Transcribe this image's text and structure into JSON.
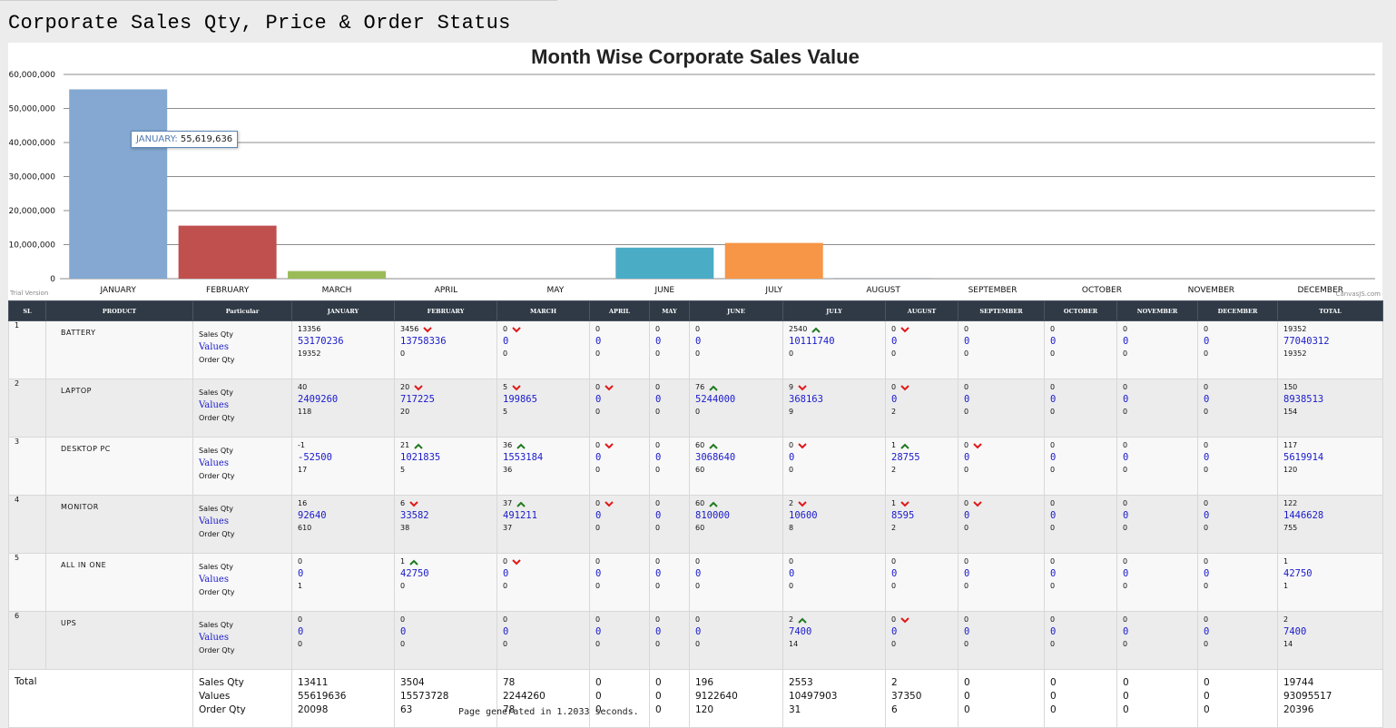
{
  "page": {
    "title": "Corporate Sales Qty, Price & Order Status",
    "footer": "Page generated in 1.2033 seconds."
  },
  "chart_data": {
    "type": "bar",
    "title": "Month Wise Corporate Sales Value",
    "categories": [
      "JANUARY",
      "FEBRUARY",
      "MARCH",
      "APRIL",
      "MAY",
      "JUNE",
      "JULY",
      "AUGUST",
      "SEPTEMBER",
      "OCTOBER",
      "NOVEMBER",
      "DECEMBER"
    ],
    "values": [
      55619636,
      15573728,
      2244260,
      0,
      0,
      9122640,
      10497903,
      37350,
      0,
      0,
      0,
      0
    ],
    "colors": [
      "#84a8d1",
      "#c0504e",
      "#9bbb59",
      "#8064a2",
      "#4bacc6",
      "#4bacc6",
      "#f79646",
      "#2c4d75",
      "#772c2a",
      "#5f7530",
      "#4d3b62",
      "#276a7c"
    ],
    "ylim": [
      0,
      60000000
    ],
    "yticks": [
      "0",
      "10,000,000",
      "20,000,000",
      "30,000,000",
      "40,000,000",
      "50,000,000",
      "60,000,000"
    ],
    "grid": true,
    "tooltip": {
      "label": "JANUARY:",
      "value": "55,619,636"
    },
    "watermark_left": "Trial Version",
    "watermark_right": "CanvasJS.com"
  },
  "table": {
    "headers": [
      "SL",
      "PRODUCT",
      "Particular",
      "JANUARY",
      "FEBRUARY",
      "MARCH",
      "APRIL",
      "MAY",
      "JUNE",
      "JULY",
      "AUGUST",
      "SEPTEMBER",
      "OCTOBER",
      "NOVEMBER",
      "DECEMBER",
      "TOTAL"
    ],
    "particulars": {
      "qty": "Sales Qty",
      "val": "Values",
      "ord": "Order Qty"
    },
    "rows": [
      {
        "sl": "1",
        "product": "BATTERY",
        "cells": [
          {
            "q": "13356",
            "v": "53170236",
            "o": "19352",
            "a": ""
          },
          {
            "q": "3456",
            "v": "13758336",
            "o": "0",
            "a": "down"
          },
          {
            "q": "0",
            "v": "0",
            "o": "0",
            "a": "down"
          },
          {
            "q": "0",
            "v": "0",
            "o": "0",
            "a": ""
          },
          {
            "q": "0",
            "v": "0",
            "o": "0",
            "a": ""
          },
          {
            "q": "0",
            "v": "0",
            "o": "0",
            "a": ""
          },
          {
            "q": "2540",
            "v": "10111740",
            "o": "0",
            "a": "up"
          },
          {
            "q": "0",
            "v": "0",
            "o": "0",
            "a": "down"
          },
          {
            "q": "0",
            "v": "0",
            "o": "0",
            "a": ""
          },
          {
            "q": "0",
            "v": "0",
            "o": "0",
            "a": ""
          },
          {
            "q": "0",
            "v": "0",
            "o": "0",
            "a": ""
          },
          {
            "q": "0",
            "v": "0",
            "o": "0",
            "a": ""
          },
          {
            "q": "19352",
            "v": "77040312",
            "o": "19352",
            "a": ""
          }
        ]
      },
      {
        "sl": "2",
        "product": "LAPTOP",
        "cells": [
          {
            "q": "40",
            "v": "2409260",
            "o": "118",
            "a": ""
          },
          {
            "q": "20",
            "v": "717225",
            "o": "20",
            "a": "down"
          },
          {
            "q": "5",
            "v": "199865",
            "o": "5",
            "a": "down"
          },
          {
            "q": "0",
            "v": "0",
            "o": "0",
            "a": "down"
          },
          {
            "q": "0",
            "v": "0",
            "o": "0",
            "a": ""
          },
          {
            "q": "76",
            "v": "5244000",
            "o": "0",
            "a": "up"
          },
          {
            "q": "9",
            "v": "368163",
            "o": "9",
            "a": "down"
          },
          {
            "q": "0",
            "v": "0",
            "o": "2",
            "a": "down"
          },
          {
            "q": "0",
            "v": "0",
            "o": "0",
            "a": ""
          },
          {
            "q": "0",
            "v": "0",
            "o": "0",
            "a": ""
          },
          {
            "q": "0",
            "v": "0",
            "o": "0",
            "a": ""
          },
          {
            "q": "0",
            "v": "0",
            "o": "0",
            "a": ""
          },
          {
            "q": "150",
            "v": "8938513",
            "o": "154",
            "a": ""
          }
        ]
      },
      {
        "sl": "3",
        "product": "DESKTOP PC",
        "cells": [
          {
            "q": "-1",
            "v": "-52500",
            "o": "17",
            "a": ""
          },
          {
            "q": "21",
            "v": "1021835",
            "o": "5",
            "a": "up"
          },
          {
            "q": "36",
            "v": "1553184",
            "o": "36",
            "a": "up"
          },
          {
            "q": "0",
            "v": "0",
            "o": "0",
            "a": "down"
          },
          {
            "q": "0",
            "v": "0",
            "o": "0",
            "a": ""
          },
          {
            "q": "60",
            "v": "3068640",
            "o": "60",
            "a": "up"
          },
          {
            "q": "0",
            "v": "0",
            "o": "0",
            "a": "down"
          },
          {
            "q": "1",
            "v": "28755",
            "o": "2",
            "a": "up"
          },
          {
            "q": "0",
            "v": "0",
            "o": "0",
            "a": "down"
          },
          {
            "q": "0",
            "v": "0",
            "o": "0",
            "a": ""
          },
          {
            "q": "0",
            "v": "0",
            "o": "0",
            "a": ""
          },
          {
            "q": "0",
            "v": "0",
            "o": "0",
            "a": ""
          },
          {
            "q": "117",
            "v": "5619914",
            "o": "120",
            "a": ""
          }
        ]
      },
      {
        "sl": "4",
        "product": "MONITOR",
        "cells": [
          {
            "q": "16",
            "v": "92640",
            "o": "610",
            "a": ""
          },
          {
            "q": "6",
            "v": "33582",
            "o": "38",
            "a": "down"
          },
          {
            "q": "37",
            "v": "491211",
            "o": "37",
            "a": "up"
          },
          {
            "q": "0",
            "v": "0",
            "o": "0",
            "a": "down"
          },
          {
            "q": "0",
            "v": "0",
            "o": "0",
            "a": ""
          },
          {
            "q": "60",
            "v": "810000",
            "o": "60",
            "a": "up"
          },
          {
            "q": "2",
            "v": "10600",
            "o": "8",
            "a": "down"
          },
          {
            "q": "1",
            "v": "8595",
            "o": "2",
            "a": "down"
          },
          {
            "q": "0",
            "v": "0",
            "o": "0",
            "a": "down"
          },
          {
            "q": "0",
            "v": "0",
            "o": "0",
            "a": ""
          },
          {
            "q": "0",
            "v": "0",
            "o": "0",
            "a": ""
          },
          {
            "q": "0",
            "v": "0",
            "o": "0",
            "a": ""
          },
          {
            "q": "122",
            "v": "1446628",
            "o": "755",
            "a": ""
          }
        ]
      },
      {
        "sl": "5",
        "product": "ALL IN ONE",
        "cells": [
          {
            "q": "0",
            "v": "0",
            "o": "1",
            "a": ""
          },
          {
            "q": "1",
            "v": "42750",
            "o": "0",
            "a": "up"
          },
          {
            "q": "0",
            "v": "0",
            "o": "0",
            "a": "down"
          },
          {
            "q": "0",
            "v": "0",
            "o": "0",
            "a": ""
          },
          {
            "q": "0",
            "v": "0",
            "o": "0",
            "a": ""
          },
          {
            "q": "0",
            "v": "0",
            "o": "0",
            "a": ""
          },
          {
            "q": "0",
            "v": "0",
            "o": "0",
            "a": ""
          },
          {
            "q": "0",
            "v": "0",
            "o": "0",
            "a": ""
          },
          {
            "q": "0",
            "v": "0",
            "o": "0",
            "a": ""
          },
          {
            "q": "0",
            "v": "0",
            "o": "0",
            "a": ""
          },
          {
            "q": "0",
            "v": "0",
            "o": "0",
            "a": ""
          },
          {
            "q": "0",
            "v": "0",
            "o": "0",
            "a": ""
          },
          {
            "q": "1",
            "v": "42750",
            "o": "1",
            "a": ""
          }
        ]
      },
      {
        "sl": "6",
        "product": "UPS",
        "cells": [
          {
            "q": "0",
            "v": "0",
            "o": "0",
            "a": ""
          },
          {
            "q": "0",
            "v": "0",
            "o": "0",
            "a": ""
          },
          {
            "q": "0",
            "v": "0",
            "o": "0",
            "a": ""
          },
          {
            "q": "0",
            "v": "0",
            "o": "0",
            "a": ""
          },
          {
            "q": "0",
            "v": "0",
            "o": "0",
            "a": ""
          },
          {
            "q": "0",
            "v": "0",
            "o": "0",
            "a": ""
          },
          {
            "q": "2",
            "v": "7400",
            "o": "14",
            "a": "up"
          },
          {
            "q": "0",
            "v": "0",
            "o": "0",
            "a": "down"
          },
          {
            "q": "0",
            "v": "0",
            "o": "0",
            "a": ""
          },
          {
            "q": "0",
            "v": "0",
            "o": "0",
            "a": ""
          },
          {
            "q": "0",
            "v": "0",
            "o": "0",
            "a": ""
          },
          {
            "q": "0",
            "v": "0",
            "o": "0",
            "a": ""
          },
          {
            "q": "2",
            "v": "7400",
            "o": "14",
            "a": ""
          }
        ]
      }
    ],
    "total": {
      "label": "Total",
      "cells": [
        {
          "q": "13411",
          "v": "55619636",
          "o": "20098"
        },
        {
          "q": "3504",
          "v": "15573728",
          "o": "63"
        },
        {
          "q": "78",
          "v": "2244260",
          "o": "78"
        },
        {
          "q": "0",
          "v": "0",
          "o": "0"
        },
        {
          "q": "0",
          "v": "0",
          "o": "0"
        },
        {
          "q": "196",
          "v": "9122640",
          "o": "120"
        },
        {
          "q": "2553",
          "v": "10497903",
          "o": "31"
        },
        {
          "q": "2",
          "v": "37350",
          "o": "6"
        },
        {
          "q": "0",
          "v": "0",
          "o": "0"
        },
        {
          "q": "0",
          "v": "0",
          "o": "0"
        },
        {
          "q": "0",
          "v": "0",
          "o": "0"
        },
        {
          "q": "0",
          "v": "0",
          "o": "0"
        },
        {
          "q": "19744",
          "v": "93095517",
          "o": "20396"
        }
      ]
    },
    "arrow_colors": {
      "up": "#1e7a1e",
      "down": "#e01818"
    }
  }
}
